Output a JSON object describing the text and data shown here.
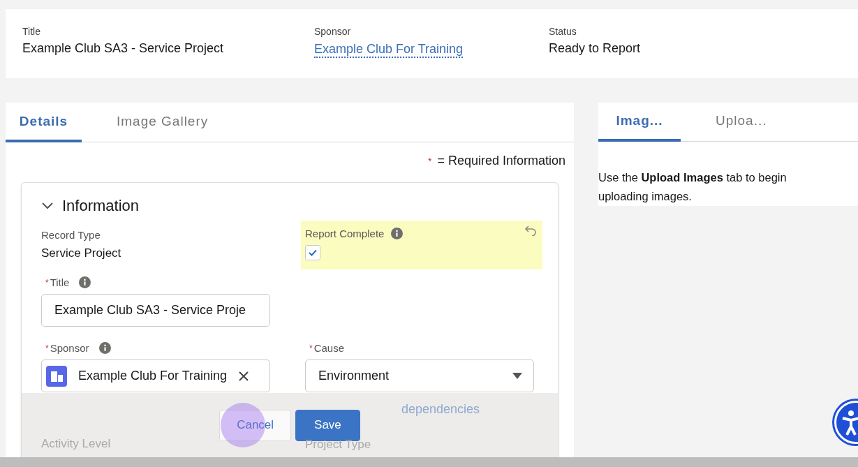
{
  "header": {
    "fields": [
      {
        "label": "Title",
        "value": "Example Club SA3 - Service Project",
        "kind": "text"
      },
      {
        "label": "Sponsor",
        "value": "Example Club For Training",
        "kind": "link"
      },
      {
        "label": "Status",
        "value": "Ready to Report",
        "kind": "text"
      }
    ]
  },
  "main_tabs": [
    {
      "label": "Details",
      "selected": true
    },
    {
      "label": "Image Gallery",
      "selected": false
    }
  ],
  "required_mark": "*",
  "required_note": "= Required Information",
  "section": {
    "title": "Information",
    "expanded": true
  },
  "record_type": {
    "label": "Record Type",
    "value": "Service Project"
  },
  "report_complete": {
    "label": "Report Complete",
    "checked": true,
    "changed": true
  },
  "title_field": {
    "label": "Title",
    "required": true,
    "value": "Example Club SA3 - Service Proje"
  },
  "sponsor_field": {
    "label": "Sponsor",
    "required": true,
    "value": "Example Club For Training"
  },
  "cause_field": {
    "label": "Cause",
    "required": true,
    "value": "Environment"
  },
  "behind_footer": {
    "link": "dependencies",
    "labels": [
      "Activity Level",
      "Project Type"
    ]
  },
  "footer": {
    "buttons": [
      {
        "label": "Cancel",
        "kind": "neutral",
        "highlighted": true
      },
      {
        "label": "Save",
        "kind": "brand",
        "highlighted": false
      }
    ]
  },
  "side_tabs": [
    {
      "label": "Imag...",
      "selected": true
    },
    {
      "label": "Uploa...",
      "selected": false
    }
  ],
  "side_message": "Use the **Upload Images** tab to begin uploading images."
}
